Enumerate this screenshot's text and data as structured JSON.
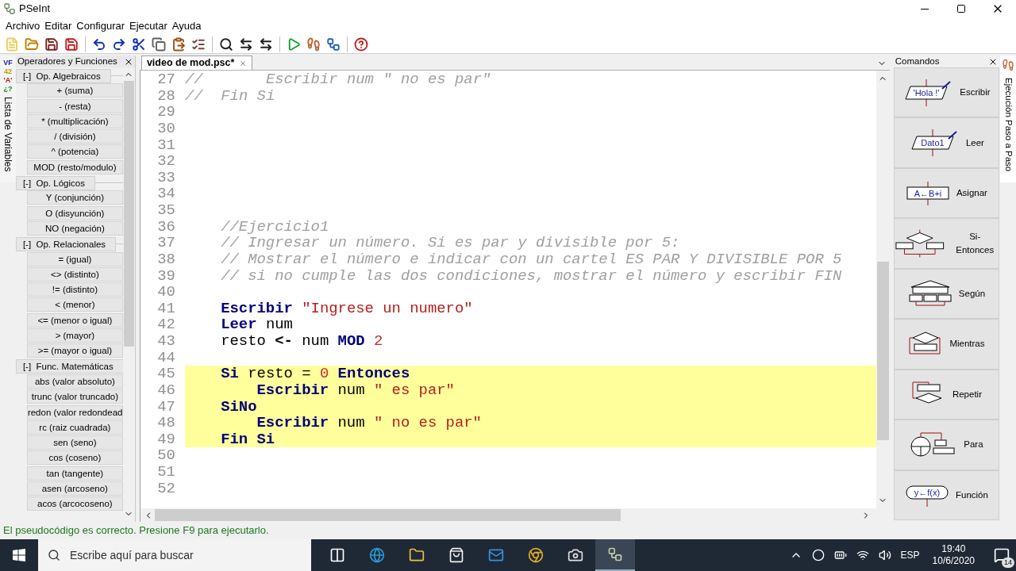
{
  "window": {
    "title": "PSeInt"
  },
  "menu": [
    "Archivo",
    "Editar",
    "Configurar",
    "Ejecutar",
    "Ayuda"
  ],
  "variables_strip": {
    "type_marks": [
      {
        "text": "VF",
        "color": "#1a1aa0"
      },
      {
        "text": "42",
        "color": "#b8a000"
      },
      {
        "text": "'A'",
        "color": "#c01010"
      },
      {
        "text": "¿?",
        "color": "#109010"
      }
    ],
    "label": "Lista de Variables"
  },
  "operators_panel": {
    "title": "Operadores y Funciones",
    "groups": [
      {
        "title": "Op. Algebraicos",
        "toggle": "[-]",
        "items": [
          "+ (suma)",
          "- (resta)",
          "* (multiplicación)",
          "/ (división)",
          "^ (potencia)",
          "MOD (resto/modulo)"
        ]
      },
      {
        "title": "Op. Lógicos",
        "toggle": "[-]",
        "items": [
          "Y (conjunción)",
          "O (disyunción)",
          "NO (negación)"
        ]
      },
      {
        "title": "Op. Relacionales",
        "toggle": "[-]",
        "items": [
          "= (igual)",
          "<> (distinto)",
          "!= (distinto)",
          "< (menor)",
          "<= (menor o igual)",
          "> (mayor)",
          ">= (mayor o igual)"
        ]
      },
      {
        "title": "Func. Matemáticas",
        "toggle": "[-]",
        "items": [
          "abs (valor absoluto)",
          "trunc (valor truncado)",
          "redon (valor redondead",
          "rc (raiz cuadrada)",
          "sen (seno)",
          "cos (coseno)",
          "tan (tangente)",
          "asen (arcoseno)",
          "acos (arcocoseno)"
        ]
      }
    ]
  },
  "editor": {
    "tabs": [
      {
        "label": "video de mod.psc*",
        "selected": true
      }
    ],
    "lines": [
      {
        "number": "27",
        "highlighted": false,
        "indented": false,
        "segments": [
          {
            "kind": "comment",
            "text": "//       Escribir num \" no es par\""
          }
        ]
      },
      {
        "number": "28",
        "highlighted": false,
        "indented": false,
        "segments": [
          {
            "kind": "comment",
            "text": "//  Fin Si"
          }
        ]
      },
      {
        "number": "29",
        "highlighted": false
      },
      {
        "number": "30",
        "highlighted": false
      },
      {
        "number": "31",
        "highlighted": false
      },
      {
        "number": "32",
        "highlighted": false
      },
      {
        "number": "33",
        "highlighted": false
      },
      {
        "number": "34",
        "highlighted": false
      },
      {
        "number": "35",
        "highlighted": false
      },
      {
        "number": "36",
        "highlighted": false,
        "indented": true,
        "segments": [
          {
            "kind": "comment",
            "text": "//Ejercicio1"
          }
        ]
      },
      {
        "number": "37",
        "highlighted": false,
        "indented": true,
        "segments": [
          {
            "kind": "comment",
            "text": "// Ingresar un número. Si es par y divisible por 5:"
          }
        ]
      },
      {
        "number": "38",
        "highlighted": false,
        "indented": true,
        "segments": [
          {
            "kind": "comment",
            "text": "// Mostrar el número e indicar con un cartel ES PAR Y DIVISIBLE POR 5"
          }
        ]
      },
      {
        "number": "39",
        "highlighted": false,
        "indented": true,
        "segments": [
          {
            "kind": "comment",
            "text": "// si no cumple las dos condiciones, mostrar el número y escribir FIN"
          }
        ]
      },
      {
        "number": "40",
        "highlighted": false
      },
      {
        "number": "41",
        "highlighted": false,
        "indented": true,
        "segments": [
          {
            "kind": "keyword",
            "text": "Escribir"
          },
          {
            "kind": "string",
            "text": " \"Ingrese un numero\""
          }
        ]
      },
      {
        "number": "42",
        "highlighted": false,
        "indented": true,
        "segments": [
          {
            "kind": "keyword",
            "text": "Leer"
          },
          {
            "kind": "plain",
            "text": " num"
          }
        ]
      },
      {
        "number": "43",
        "highlighted": false,
        "indented": true,
        "segments": [
          {
            "kind": "plain",
            "text": "resto "
          },
          {
            "kind": "operator",
            "text": "<-"
          },
          {
            "kind": "plain",
            "text": " num "
          },
          {
            "kind": "keyword",
            "text": "MOD"
          },
          {
            "kind": "number",
            "text": " 2"
          }
        ]
      },
      {
        "number": "44",
        "highlighted": false
      },
      {
        "number": "45",
        "highlighted": true,
        "indented": true,
        "segments": [
          {
            "kind": "keyword",
            "text": "Si"
          },
          {
            "kind": "plain",
            "text": " resto = "
          },
          {
            "kind": "number",
            "text": "0"
          },
          {
            "kind": "keyword",
            "text": " Entonces"
          }
        ],
        "children": [
          {
            "number": "46",
            "highlighted": true,
            "indented": true,
            "segments": [
              {
                "kind": "keyword",
                "text": "Escribir"
              },
              {
                "kind": "plain",
                "text": " num "
              },
              {
                "kind": "string",
                "text": "\" es par\""
              }
            ]
          }
        ]
      },
      {
        "number": "47",
        "highlighted": true,
        "indented": true,
        "segments": [
          {
            "kind": "keyword",
            "text": "SiNo"
          }
        ],
        "children": [
          {
            "number": "48",
            "highlighted": true,
            "indented": true,
            "segments": [
              {
                "kind": "keyword",
                "text": "Escribir"
              },
              {
                "kind": "plain",
                "text": " num "
              },
              {
                "kind": "string",
                "text": "\" no es par\""
              }
            ]
          }
        ]
      },
      {
        "number": "49",
        "highlighted": true,
        "indented": true,
        "segments": [
          {
            "kind": "keyword",
            "text": "Fin Si"
          }
        ]
      },
      {
        "number": "50",
        "highlighted": false
      },
      {
        "number": "51",
        "highlighted": false
      },
      {
        "number": "52",
        "highlighted": false
      }
    ]
  },
  "commands_panel": {
    "title": "Comandos",
    "items": [
      {
        "kind": "escribir",
        "label": "Escribir",
        "icon_text": "'Hola !'"
      },
      {
        "kind": "leer",
        "label": "Leer",
        "icon_text": "Dato1"
      },
      {
        "kind": "asignar",
        "label": "Asignar",
        "icon_text": "A←B+i"
      },
      {
        "kind": "si",
        "label": "Si-Entonces"
      },
      {
        "kind": "segun",
        "label": "Según"
      },
      {
        "kind": "mientras",
        "label": "Mientras"
      },
      {
        "kind": "repetir",
        "label": "Repetir"
      },
      {
        "kind": "para",
        "label": "Para"
      },
      {
        "kind": "funcion",
        "label": "Función",
        "icon_text": "y←f(x)"
      }
    ]
  },
  "step_strip": {
    "label": "Ejecución Paso a Paso"
  },
  "status_bar": "El pseudocódigo es correcto. Presione F9 para ejecutarlo.",
  "taskbar": {
    "search_placeholder": "Escribe aquí para buscar",
    "language": "ESP",
    "time": "19:40",
    "date": "10/6/2020",
    "notifications": "14"
  }
}
